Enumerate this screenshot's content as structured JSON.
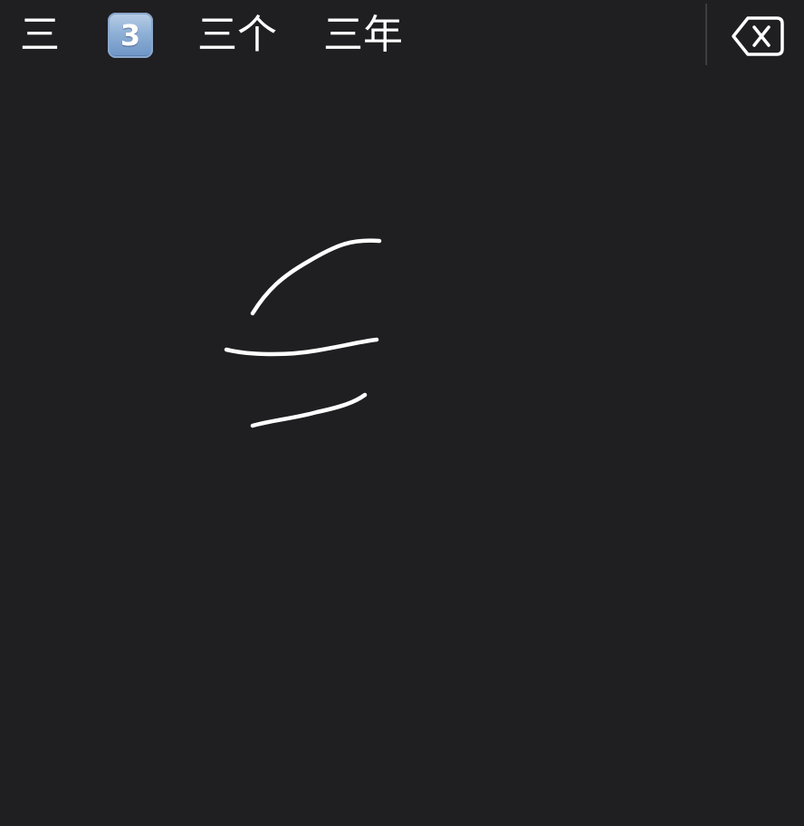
{
  "candidates": [
    "三",
    "3",
    "三个",
    "三年"
  ],
  "candidate_icons": {
    "1": "keycap-digit-three-emoji"
  },
  "delete_icon": "backspace-icon",
  "colors": {
    "background": "#1f1e21",
    "ink": "#ffffff",
    "divider": "#3d3c40"
  }
}
